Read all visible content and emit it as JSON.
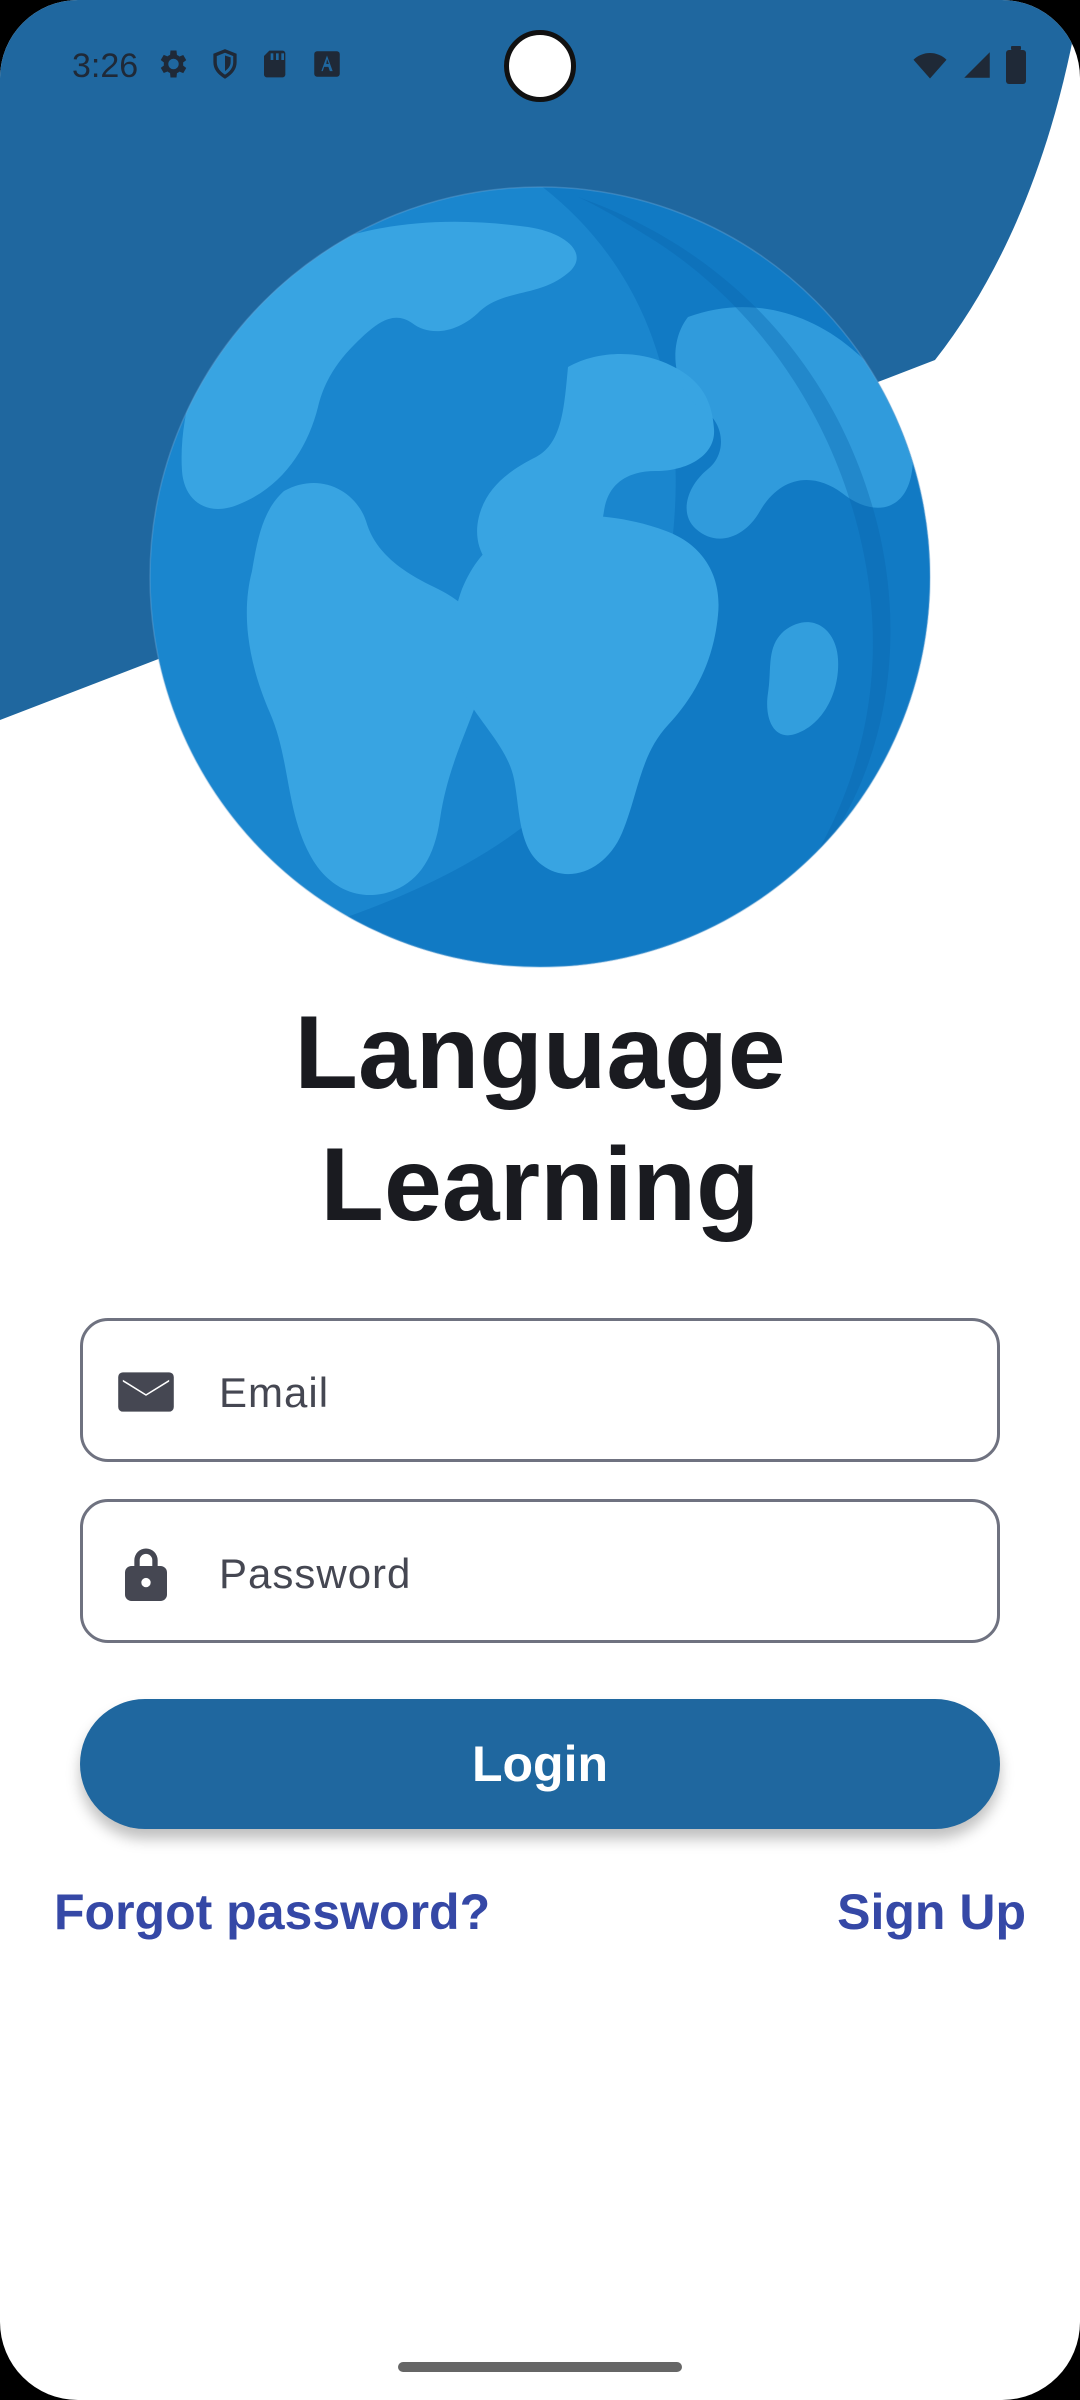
{
  "status_bar": {
    "time": "3:26",
    "left_icons": [
      "gear-icon",
      "shield-icon",
      "sd-card-icon",
      "translate-icon"
    ],
    "right_icons": [
      "wifi-icon",
      "signal-icon",
      "battery-icon"
    ]
  },
  "colors": {
    "header": "#1f679f",
    "accent": "#1f679f",
    "link": "#3548a6",
    "title": "#1a1b20"
  },
  "app": {
    "title_line_1": "Language",
    "title_line_2": "Learning"
  },
  "form": {
    "email_placeholder": "Email",
    "password_placeholder": "Password",
    "email_icon": "mail-icon",
    "password_icon": "lock-icon"
  },
  "actions": {
    "login_label": "Login",
    "forgot_password_label": "Forgot password?",
    "signup_label": "Sign Up"
  }
}
